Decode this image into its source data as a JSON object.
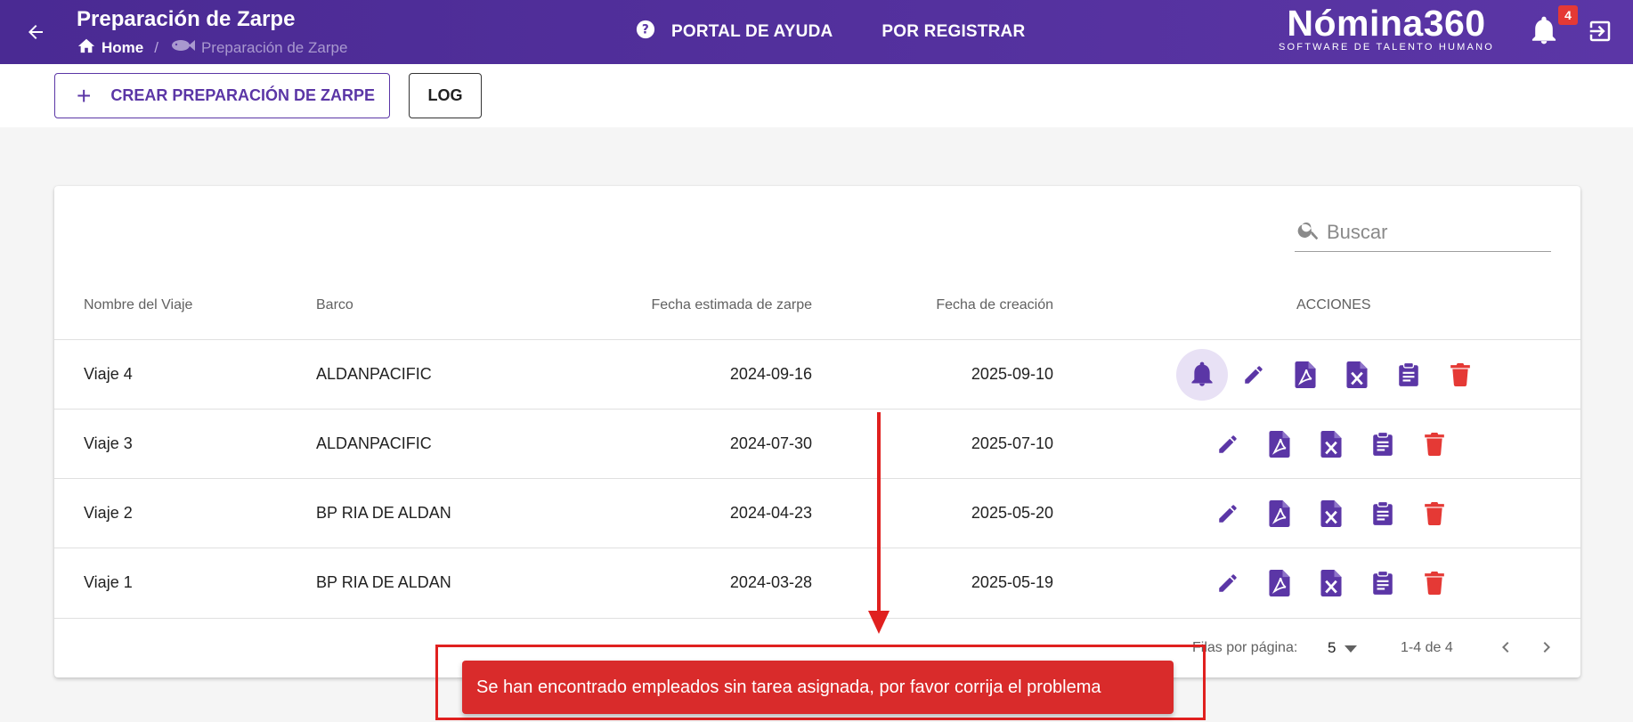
{
  "header": {
    "title": "Preparación de Zarpe",
    "breadcrumb": {
      "home": "Home",
      "current": "Preparación de Zarpe"
    },
    "nav": [
      {
        "label": "PORTAL DE AYUDA",
        "icon": "help-icon"
      },
      {
        "label": "POR REGISTRAR"
      }
    ],
    "logo": {
      "brand": "Nómina360",
      "tagline": "SOFTWARE DE TALENTO HUMANO"
    },
    "notifications_count": "4",
    "colors": {
      "bar": "#5b36a6",
      "accent": "#5b36a6",
      "danger": "#e53935"
    }
  },
  "toolbar": {
    "create_label": "CREAR PREPARACIÓN DE ZARPE",
    "log_label": "LOG"
  },
  "table": {
    "search_placeholder": "Buscar",
    "columns": {
      "name": "Nombre del Viaje",
      "ship": "Barco",
      "estimated": "Fecha estimada de zarpe",
      "created": "Fecha de creación",
      "actions": "ACCIONES"
    },
    "rows": [
      {
        "name": "Viaje 4",
        "ship": "ALDANPACIFIC",
        "estimated": "2024-09-16",
        "created": "2025-09-10",
        "has_notification": true
      },
      {
        "name": "Viaje 3",
        "ship": "ALDANPACIFIC",
        "estimated": "2024-07-30",
        "created": "2025-07-10",
        "has_notification": false
      },
      {
        "name": "Viaje 2",
        "ship": "BP RIA DE ALDAN",
        "estimated": "2024-04-23",
        "created": "2025-05-20",
        "has_notification": false
      },
      {
        "name": "Viaje 1",
        "ship": "BP RIA DE ALDAN",
        "estimated": "2024-03-28",
        "created": "2025-05-19",
        "has_notification": false
      }
    ],
    "pagination": {
      "rows_label": "Filas por página:",
      "rows_per_page": "5",
      "range": "1-4 de 4"
    }
  },
  "snackbar": {
    "message": "Se han encontrado empleados sin tarea asignada, por favor corrija el problema"
  }
}
